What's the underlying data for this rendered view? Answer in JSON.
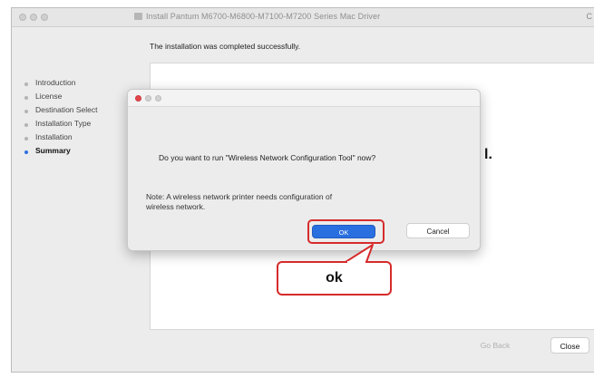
{
  "window": {
    "title": "Install Pantum M6700-M6800-M7100-M7200 Series Mac Driver",
    "edge_char": "C"
  },
  "installer": {
    "headline": "The installation was completed successfully.",
    "peek_text": "l.",
    "steps": [
      {
        "label": "Introduction",
        "active": false
      },
      {
        "label": "License",
        "active": false
      },
      {
        "label": "Destination Select",
        "active": false
      },
      {
        "label": "Installation Type",
        "active": false
      },
      {
        "label": "Installation",
        "active": false
      },
      {
        "label": "Summary",
        "active": true
      }
    ],
    "go_back_label": "Go Back",
    "close_label": "Close"
  },
  "dialog": {
    "question": "Do you want to run \"Wireless Network Configuration Tool\" now?",
    "note_line1": "Note: A wireless network printer needs configuration of",
    "note_line2": "wireless network.",
    "ok_label": "OK",
    "cancel_label": "Cancel"
  },
  "annotation": {
    "callout_text": "ok",
    "color": "#d62b2b"
  },
  "colors": {
    "accent": "#2a6fe0",
    "close_dot": "#e5484d"
  }
}
